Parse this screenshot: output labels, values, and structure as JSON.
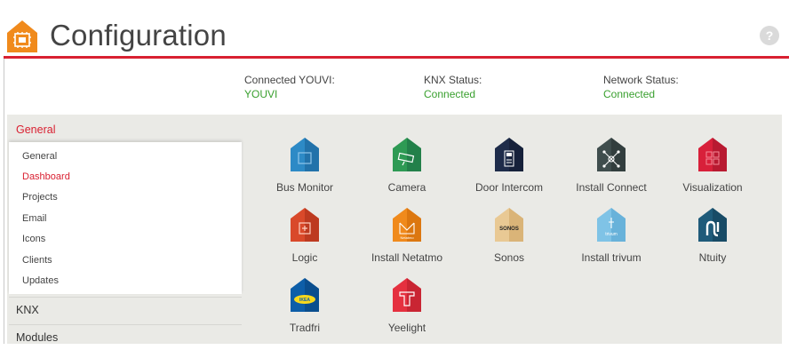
{
  "header": {
    "title": "Configuration",
    "help_symbol": "?"
  },
  "status": {
    "youvi": {
      "label": "Connected YOUVI:",
      "value": "YOUVI"
    },
    "knx": {
      "label": "KNX Status:",
      "value": "Connected"
    },
    "network": {
      "label": "Network Status:",
      "value": "Connected"
    }
  },
  "sidebar": {
    "sections": [
      {
        "label": "General",
        "active": true
      },
      {
        "label": "KNX",
        "active": false
      },
      {
        "label": "Modules",
        "active": false
      }
    ],
    "items": [
      {
        "label": "General",
        "active": false
      },
      {
        "label": "Dashboard",
        "active": true
      },
      {
        "label": "Projects",
        "active": false
      },
      {
        "label": "Email",
        "active": false
      },
      {
        "label": "Icons",
        "active": false
      },
      {
        "label": "Clients",
        "active": false
      },
      {
        "label": "Updates",
        "active": false
      }
    ]
  },
  "modules": [
    {
      "label": "Bus Monitor",
      "icon": "bus-monitor-icon",
      "color": "#2d8ac6"
    },
    {
      "label": "Camera",
      "icon": "camera-icon",
      "color": "#2e9a54"
    },
    {
      "label": "Door Intercom",
      "icon": "door-intercom-icon",
      "color": "#1e2c4a"
    },
    {
      "label": "Install Connect",
      "icon": "install-connect-icon",
      "color": "#3f4d4d"
    },
    {
      "label": "Visualization",
      "icon": "visualization-icon",
      "color": "#d8203a"
    },
    {
      "label": "Logic",
      "icon": "logic-icon",
      "color": "#d9492a"
    },
    {
      "label": "Install Netatmo",
      "icon": "netatmo-icon",
      "color": "#f08a1c",
      "icon_text": "Netatmo"
    },
    {
      "label": "Sonos",
      "icon": "sonos-icon",
      "color": "#e9c994",
      "icon_text": "SONOS"
    },
    {
      "label": "Install trivum",
      "icon": "trivum-icon",
      "color": "#7fc3e6",
      "icon_text": "trivum"
    },
    {
      "label": "Ntuity",
      "icon": "ntuity-icon",
      "color": "#1f5b7a"
    },
    {
      "label": "Tradfri",
      "icon": "tradfri-icon",
      "color": "#0d5ea8",
      "icon_text": "IKEA"
    },
    {
      "label": "Yeelight",
      "icon": "yeelight-icon",
      "color": "#e5303f"
    }
  ]
}
